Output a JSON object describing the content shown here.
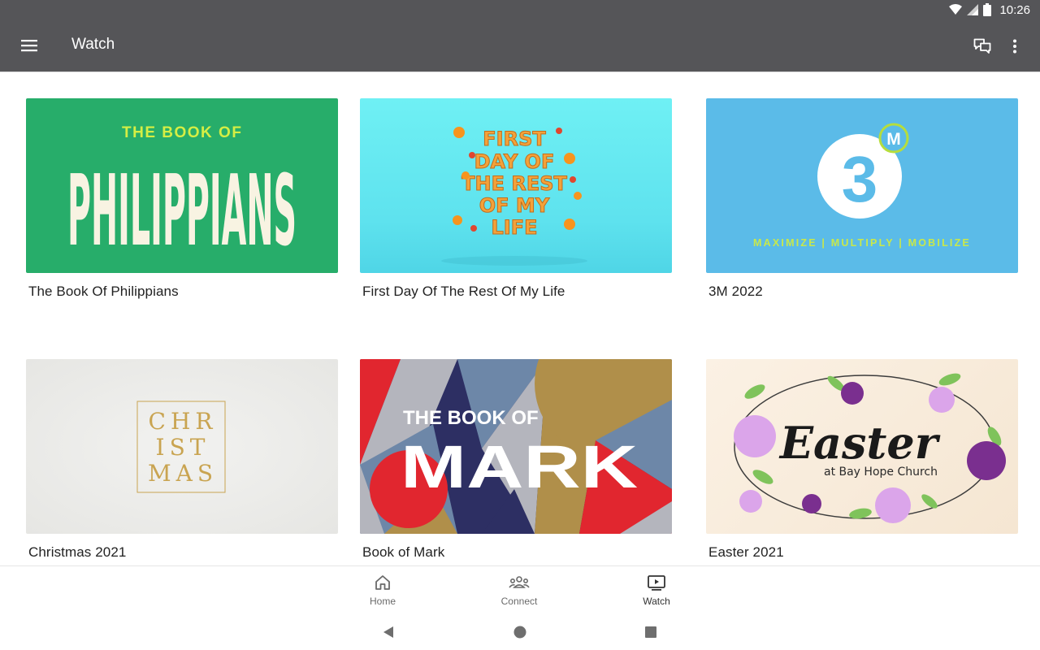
{
  "status_bar": {
    "time": "10:26",
    "icons": [
      "wifi-icon",
      "signal-icon",
      "battery-icon"
    ]
  },
  "app_bar": {
    "title": "Watch",
    "menu_icon": "menu-icon",
    "actions": [
      "chat-icon",
      "more-vert-icon"
    ],
    "background": "#555558"
  },
  "thumbnail_text": {
    "philippians_top": "THE BOOK OF",
    "philippians_main": "PHILIPPIANS",
    "firstday": [
      "FIRST",
      "DAY OF",
      "THE REST",
      "OF MY",
      "LIFE"
    ],
    "three_m_number": "3",
    "three_m_letter": "M",
    "three_m_tagline": "MAXIMIZE | MULTIPLY | MOBILIZE",
    "christmas": [
      "CHR",
      "IST",
      "MAS"
    ],
    "mark_top": "THE BOOK OF",
    "mark_main": "MARK",
    "easter_main": "Easter",
    "easter_sub": "at Bay Hope Church"
  },
  "series": [
    {
      "title": "The Book Of Philippians",
      "thumb_icon": "philippians-artwork",
      "accent": "#27ad6a"
    },
    {
      "title": "First Day Of The Rest Of My Life",
      "thumb_icon": "breakfast-lettering-artwork",
      "accent": "#64e6ef"
    },
    {
      "title": "3M 2022",
      "thumb_icon": "3m-logo-artwork",
      "accent": "#5bbbe8"
    },
    {
      "title": "Christmas 2021",
      "thumb_icon": "christmas-gold-foil-artwork",
      "accent": "#ececea"
    },
    {
      "title": "Book of Mark",
      "thumb_icon": "mark-geometric-artwork",
      "accent": "#2d2f63"
    },
    {
      "title": "Easter 2021",
      "thumb_icon": "easter-floral-artwork",
      "accent": "#f7ead9"
    }
  ],
  "bottom_nav": [
    {
      "label": "Home",
      "icon": "home-icon",
      "active": false
    },
    {
      "label": "Connect",
      "icon": "people-icon",
      "active": false
    },
    {
      "label": "Watch",
      "icon": "play-screen-icon",
      "active": true
    }
  ],
  "system_nav": [
    "back-icon",
    "home-circle-icon",
    "recents-icon"
  ]
}
